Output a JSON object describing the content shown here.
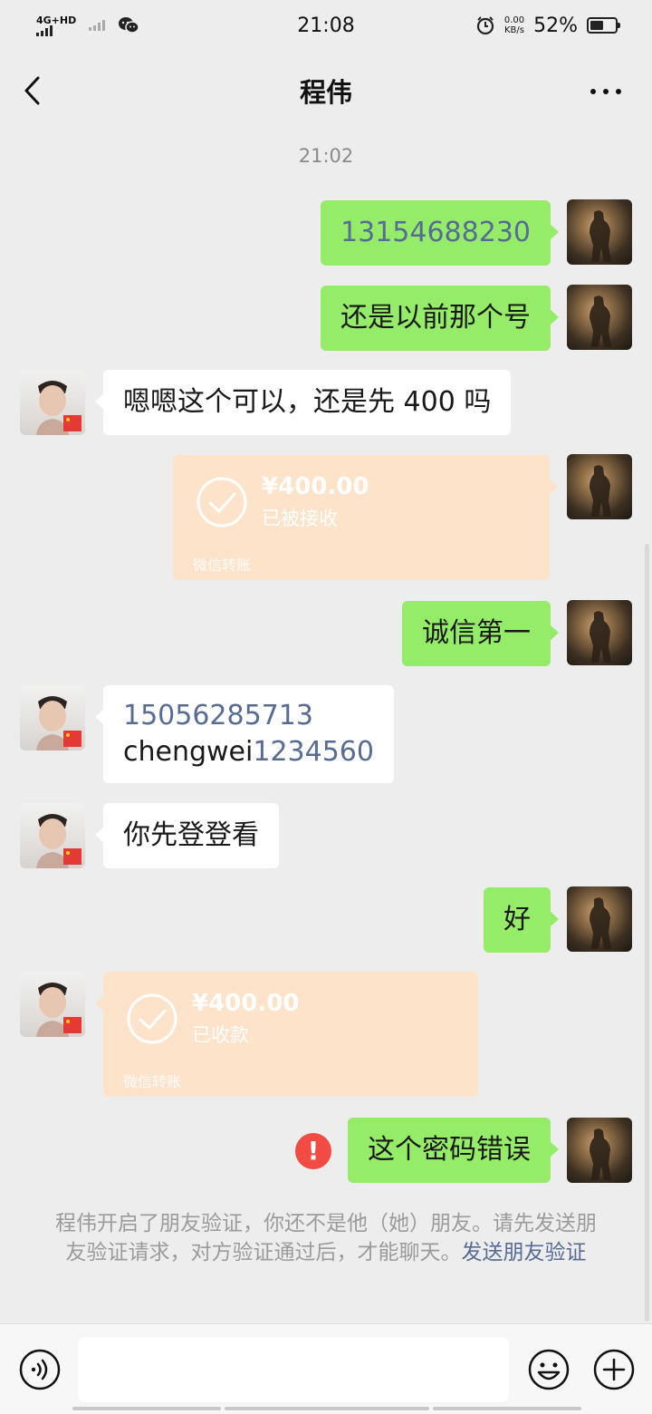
{
  "status_bar": {
    "network": "4G+HD",
    "time": "21:08",
    "speed_value": "0.00",
    "speed_unit": "KB/s",
    "battery": "52%",
    "battery_level": 0.52
  },
  "header": {
    "title": "程伟",
    "back_icon": "chevron-left-icon",
    "more_icon": "ellipsis-icon"
  },
  "chat": {
    "timestamp": "21:02",
    "messages": [
      {
        "sender": "me",
        "type": "text",
        "text": "13154688230"
      },
      {
        "sender": "me",
        "type": "text",
        "text": "还是以前那个号"
      },
      {
        "sender": "other",
        "type": "text",
        "text": "嗯嗯这个可以，还是先 400 吗"
      },
      {
        "sender": "me",
        "type": "transfer",
        "amount": "¥400.00",
        "status": "已被接收",
        "footer": "微信转账"
      },
      {
        "sender": "me",
        "type": "text",
        "text": "诚信第一"
      },
      {
        "sender": "other",
        "type": "text",
        "line1": "15056285713",
        "line2_prefix": "chengwei",
        "line2_number": "1234560"
      },
      {
        "sender": "other",
        "type": "text",
        "text": "你先登登看"
      },
      {
        "sender": "me",
        "type": "text",
        "text": "好"
      },
      {
        "sender": "other",
        "type": "transfer",
        "amount": "¥400.00",
        "status": "已收款",
        "footer": "微信转账"
      },
      {
        "sender": "me",
        "type": "text",
        "text": "这个密码错误",
        "error": "!"
      }
    ],
    "notice": {
      "text": "程伟开启了朋友验证，你还不是他（她）朋友。请先发送朋友验证请求，对方验证通过后，才能聊天。",
      "link": "发送朋友验证"
    }
  },
  "input_bar": {
    "voice_icon": "voice-icon",
    "emoji_icon": "emoji-icon",
    "plus_icon": "plus-icon"
  },
  "colors": {
    "background": "#ededed",
    "my_bubble": "#95ec69",
    "other_bubble": "#ffffff",
    "transfer": "#fde3c9",
    "link": "#576b95",
    "error": "#f24b44"
  }
}
